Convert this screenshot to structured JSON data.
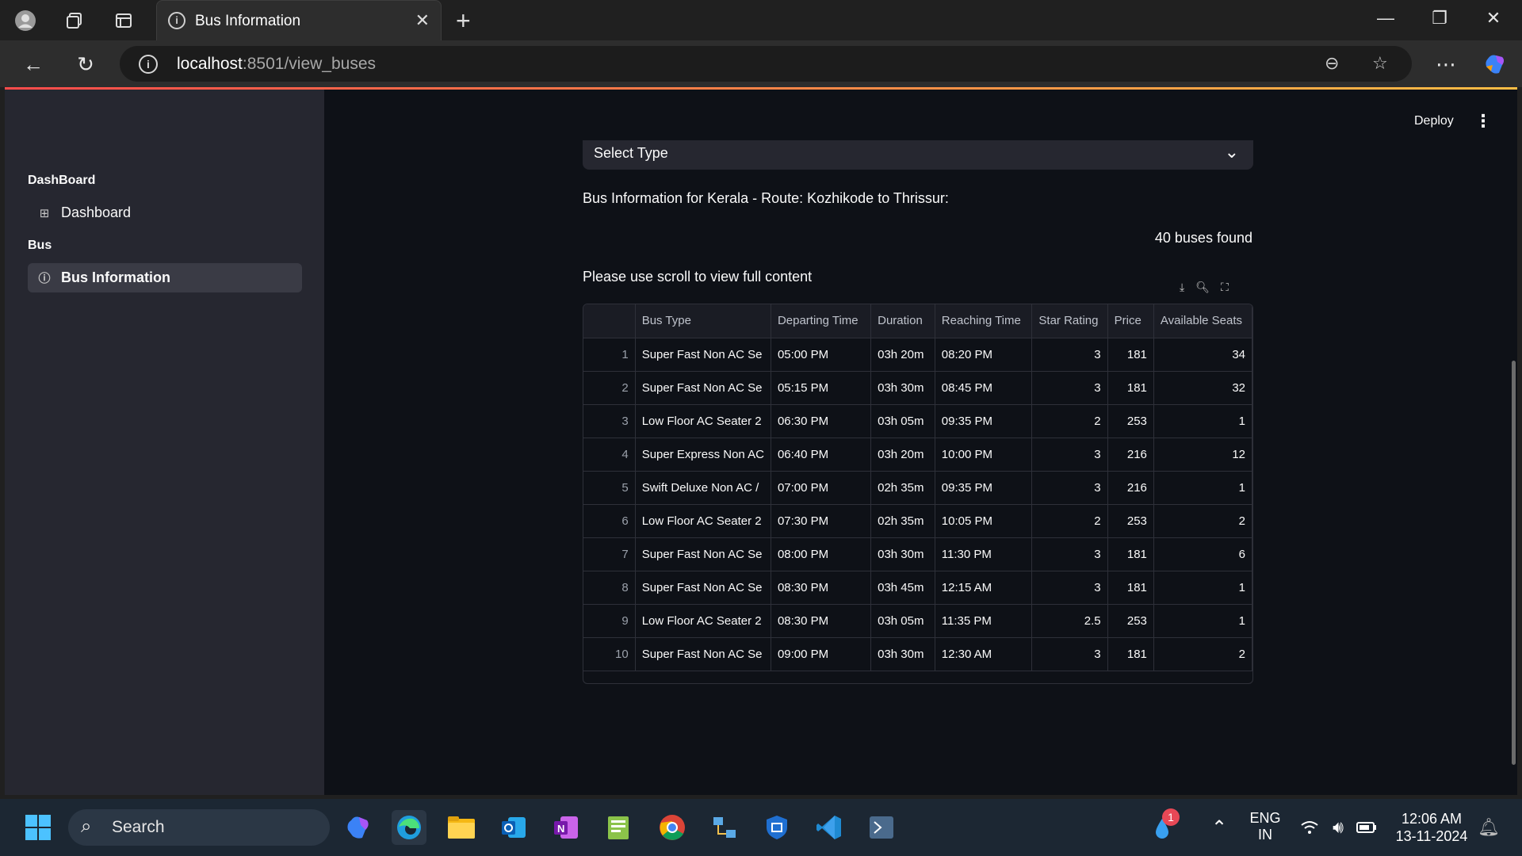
{
  "browser": {
    "tab_title": "Bus Information",
    "url_host": "localhost",
    "url_path": ":8501/view_buses"
  },
  "app": {
    "deploy_label": "Deploy",
    "sidebar": {
      "sections": [
        {
          "title": "DashBoard",
          "items": [
            {
              "label": "Dashboard",
              "icon": "grid-icon",
              "active": false
            }
          ]
        },
        {
          "title": "Bus",
          "items": [
            {
              "label": "Bus Information",
              "icon": "info-icon",
              "active": true
            }
          ]
        }
      ]
    },
    "select_type": {
      "label": "Select Type"
    },
    "info_line": "Bus Information for Kerala - Route: Kozhikode to Thrissur:",
    "found_text": "40 buses found",
    "scroll_note": "Please use scroll to view full content",
    "table": {
      "columns": [
        "",
        "Bus Type",
        "Departing Time",
        "Duration",
        "Reaching Time",
        "Star Rating",
        "Price",
        "Available Seats"
      ],
      "rows": [
        [
          "1",
          "Super Fast Non AC Se",
          "05:00 PM",
          "03h 20m",
          "08:20 PM",
          "3",
          "181",
          "34"
        ],
        [
          "2",
          "Super Fast Non AC Se",
          "05:15 PM",
          "03h 30m",
          "08:45 PM",
          "3",
          "181",
          "32"
        ],
        [
          "3",
          "Low Floor AC Seater 2",
          "06:30 PM",
          "03h 05m",
          "09:35 PM",
          "2",
          "253",
          "1"
        ],
        [
          "4",
          "Super Express Non AC",
          "06:40 PM",
          "03h 20m",
          "10:00 PM",
          "3",
          "216",
          "12"
        ],
        [
          "5",
          "Swift Deluxe Non AC /",
          "07:00 PM",
          "02h 35m",
          "09:35 PM",
          "3",
          "216",
          "1"
        ],
        [
          "6",
          "Low Floor AC Seater 2",
          "07:30 PM",
          "02h 35m",
          "10:05 PM",
          "2",
          "253",
          "2"
        ],
        [
          "7",
          "Super Fast Non AC Se",
          "08:00 PM",
          "03h 30m",
          "11:30 PM",
          "3",
          "181",
          "6"
        ],
        [
          "8",
          "Super Fast Non AC Se",
          "08:30 PM",
          "03h 45m",
          "12:15 AM",
          "3",
          "181",
          "1"
        ],
        [
          "9",
          "Low Floor AC Seater 2",
          "08:30 PM",
          "03h 05m",
          "11:35 PM",
          "2.5",
          "253",
          "1"
        ],
        [
          "10",
          "Super Fast Non AC Se",
          "09:00 PM",
          "03h 30m",
          "12:30 AM",
          "3",
          "181",
          "2"
        ]
      ]
    }
  },
  "taskbar": {
    "search_label": "Search",
    "lang_line1": "ENG",
    "lang_line2": "IN",
    "time": "12:06 AM",
    "date": "13-11-2024",
    "notification_count": "1"
  },
  "colors": {
    "accent": "#ff4b4b",
    "page_bg": "#0e1117",
    "sidebar_bg": "#262730"
  }
}
